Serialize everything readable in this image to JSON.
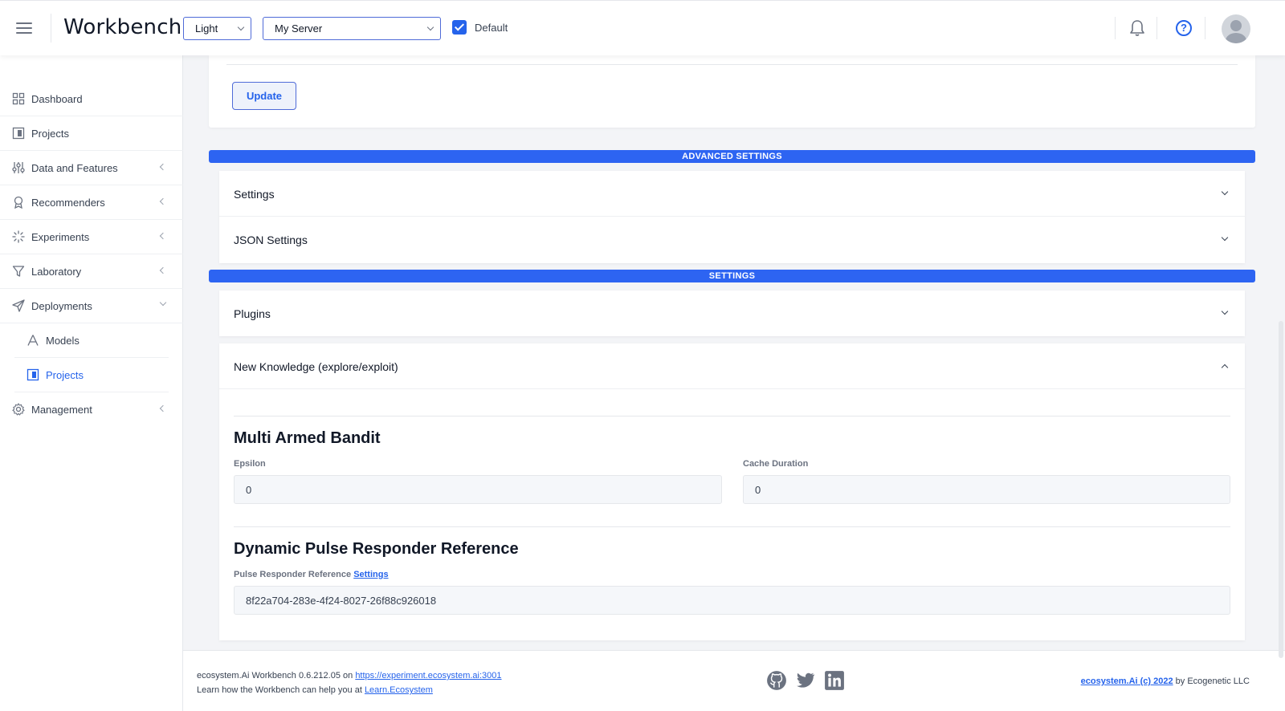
{
  "header": {
    "title": "Workbench",
    "theme_select": "Light",
    "server_select": "My Server",
    "default_label": "Default",
    "default_checked": true
  },
  "sidebar": {
    "items": [
      {
        "label": "Dashboard",
        "icon": "grid-icon"
      },
      {
        "label": "Projects",
        "icon": "project-icon"
      },
      {
        "label": "Data and Features",
        "icon": "sliders-icon"
      },
      {
        "label": "Recommenders",
        "icon": "award-icon"
      },
      {
        "label": "Experiments",
        "icon": "loader-icon"
      },
      {
        "label": "Laboratory",
        "icon": "filter-icon"
      },
      {
        "label": "Deployments",
        "icon": "send-icon"
      },
      {
        "label": "Models",
        "icon": "models-icon"
      },
      {
        "label": "Projects",
        "icon": "project-icon"
      },
      {
        "label": "Management",
        "icon": "gear-icon"
      }
    ]
  },
  "main": {
    "update_button": "Update",
    "advanced_banner": "ADVANCED SETTINGS",
    "settings_banner": "SETTINGS",
    "accordions": {
      "settings": "Settings",
      "json_settings": "JSON Settings",
      "plugins": "Plugins",
      "new_knowledge": "New Knowledge (explore/exploit)"
    },
    "mab": {
      "title": "Multi Armed Bandit",
      "epsilon_label": "Epsilon",
      "epsilon_value": "0",
      "cache_label": "Cache Duration",
      "cache_value": "0"
    },
    "dpr": {
      "title": "Dynamic Pulse Responder Reference",
      "label": "Pulse Responder Reference",
      "link": "Settings",
      "value": "8f22a704-283e-4f24-8027-26f88c926018"
    }
  },
  "footer": {
    "version_text": "ecosystem.Ai Workbench 0.6.212.05 on",
    "server_link": "https://experiment.ecosystem.ai:3001",
    "learn_text": "Learn how the Workbench can help you at",
    "learn_link": "Learn.Ecosystem",
    "copyright_link": "ecosystem.Ai (c) 2022",
    "copyright_suffix": "by Ecogenetic LLC"
  },
  "colors": {
    "accent": "#2563eb",
    "banner": "#2d64f2"
  }
}
